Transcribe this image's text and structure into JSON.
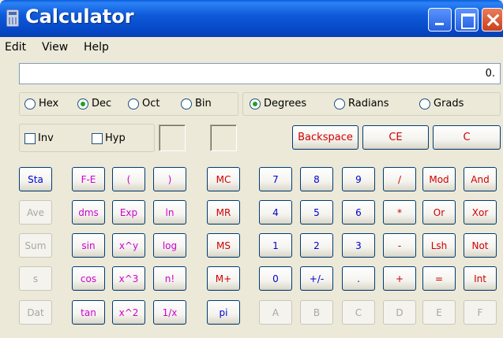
{
  "window": {
    "title": "Calculator"
  },
  "menu": [
    "Edit",
    "View",
    "Help"
  ],
  "display": {
    "value": "0."
  },
  "base_options": [
    {
      "label": "Hex",
      "selected": false
    },
    {
      "label": "Dec",
      "selected": true
    },
    {
      "label": "Oct",
      "selected": false
    },
    {
      "label": "Bin",
      "selected": false
    }
  ],
  "angle_options": [
    {
      "label": "Degrees",
      "selected": true
    },
    {
      "label": "Radians",
      "selected": false
    },
    {
      "label": "Grads",
      "selected": false
    }
  ],
  "checkboxes": [
    {
      "label": "Inv",
      "checked": false
    },
    {
      "label": "Hyp",
      "checked": false
    }
  ],
  "top_buttons": [
    "Backspace",
    "CE",
    "C"
  ],
  "stat_buttons": [
    "Sta",
    "Ave",
    "Sum",
    "s",
    "Dat"
  ],
  "sci_buttons": [
    "F-E",
    "(",
    ")",
    "dms",
    "Exp",
    "ln",
    "sin",
    "x^y",
    "log",
    "cos",
    "x^3",
    "n!",
    "tan",
    "x^2",
    "1/x"
  ],
  "memory_buttons": [
    "MC",
    "MR",
    "MS",
    "M+",
    "pi"
  ],
  "num_buttons": [
    "7",
    "8",
    "9",
    "/",
    "Mod",
    "And",
    "4",
    "5",
    "6",
    "*",
    "Or",
    "Xor",
    "1",
    "2",
    "3",
    "-",
    "Lsh",
    "Not",
    "0",
    "+/-",
    ".",
    "+",
    "=",
    "Int",
    "A",
    "B",
    "C",
    "D",
    "E",
    "F"
  ],
  "colors": {
    "title_bar": "#0A5FDB",
    "blue_text": "#0000D0",
    "magenta_text": "#D000D0",
    "red_text": "#D00000",
    "disabled_text": "#A8A8A0"
  }
}
